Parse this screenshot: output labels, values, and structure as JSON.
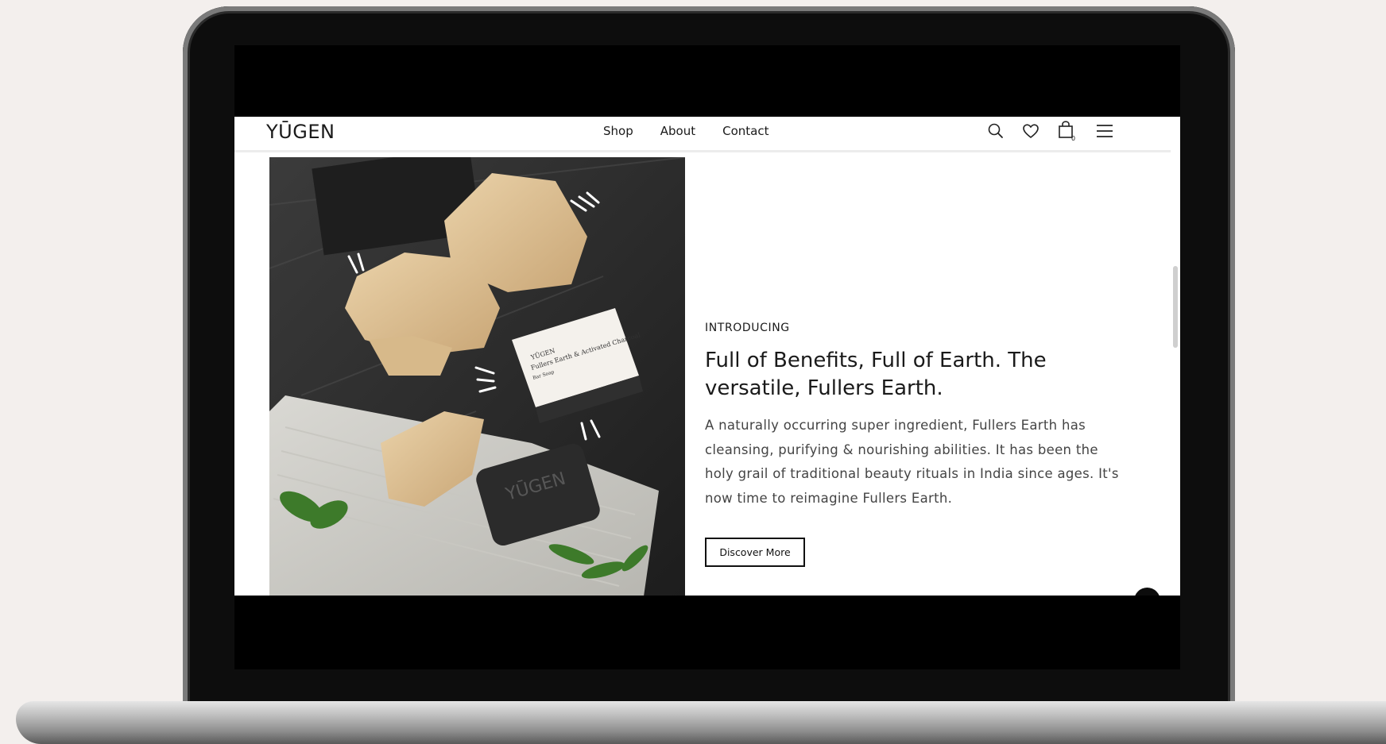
{
  "brand": {
    "logo_text": "YŪGEN"
  },
  "nav": {
    "links": [
      "Shop",
      "About",
      "Contact"
    ],
    "cart_count": "0"
  },
  "icons": [
    "search-icon",
    "heart-icon",
    "shopping-bag-icon",
    "hamburger-menu-icon",
    "chevron-up-icon"
  ],
  "hero": {
    "eyebrow": "INTRODUCING",
    "headline": "Full of Benefits, Full of Earth. The versatile, Fullers Earth.",
    "body": "A naturally occurring super ingredient, Fullers Earth has cleansing, purifying & nourishing abilities. It has been the holy grail of traditional beauty rituals in India since ages. It's now time to reimagine Fullers Earth.",
    "cta_label": "Discover More"
  },
  "product_image": {
    "box_brand": "YŪGEN",
    "box_product": "Fullers Earth & Activated Charcoal",
    "box_type": "Bar Soap",
    "soap_stamp": "YŪGEN"
  },
  "colors": {
    "page_bg": "#f3efed",
    "accent": "#0c0c0c",
    "text": "#1a1a1a"
  }
}
